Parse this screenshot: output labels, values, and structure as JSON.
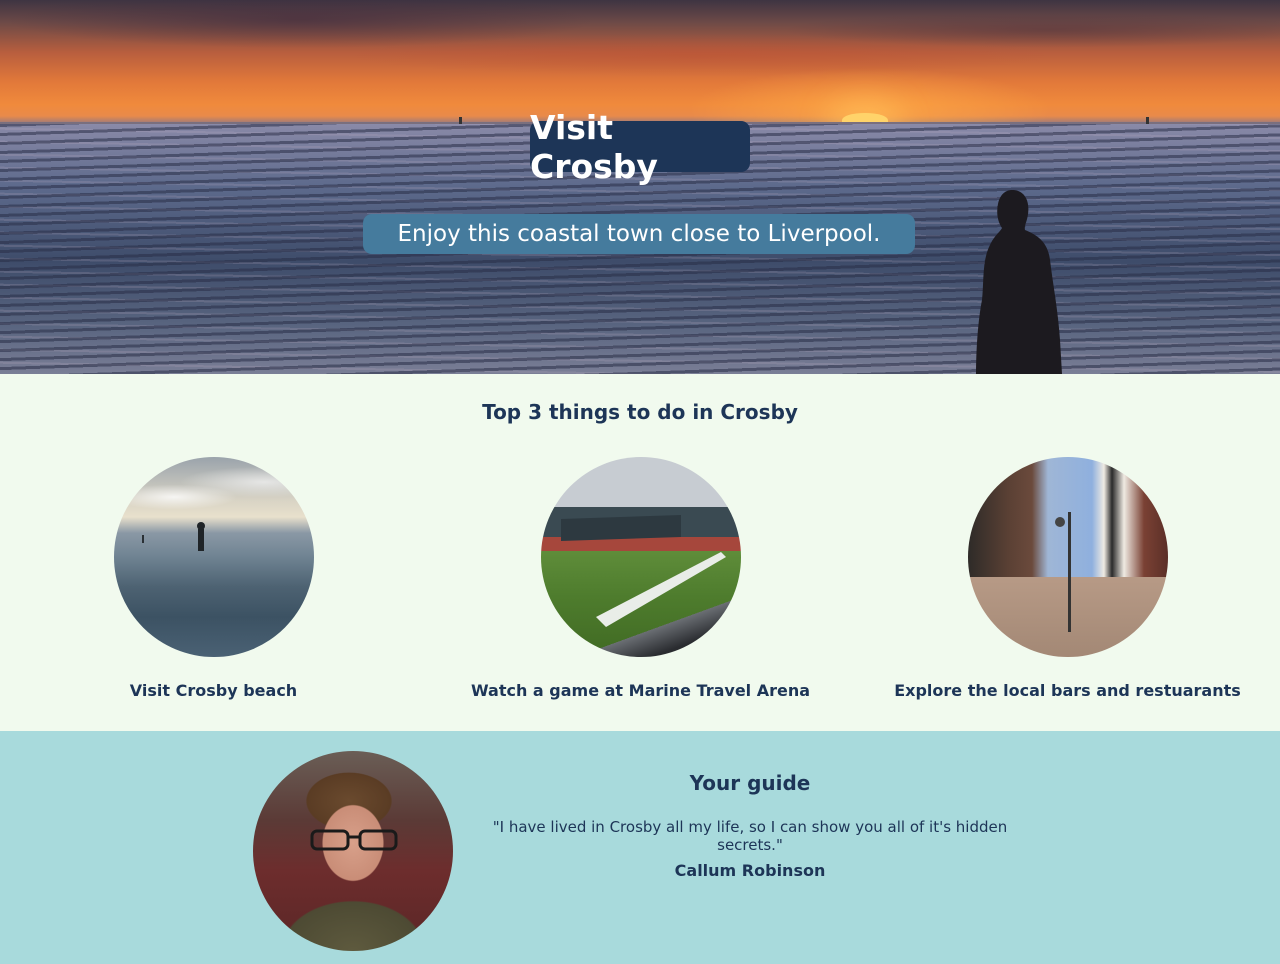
{
  "hero": {
    "title": "Visit Crosby",
    "subtitle": "Enjoy this coastal town close to Liverpool."
  },
  "top3": {
    "heading": "Top 3 things to do in Crosby",
    "items": [
      {
        "label": "Visit Crosby beach",
        "image": "beach-statue-photo"
      },
      {
        "label": "Watch a game at Marine Travel Arena",
        "image": "football-stadium-photo"
      },
      {
        "label": "Explore the local bars and restuarants",
        "image": "town-street-photo"
      }
    ]
  },
  "guide": {
    "heading": "Your guide",
    "quote": "\"I have lived in Crosby all my life, so I can show you all of it's hidden secrets.\"",
    "name": "Callum Robinson",
    "photo": "guide-portrait-photo"
  },
  "colors": {
    "dark_blue": "#1d3557",
    "mid_blue": "#457b9d",
    "light_green": "#f1faee",
    "light_teal": "#a8dadc"
  }
}
